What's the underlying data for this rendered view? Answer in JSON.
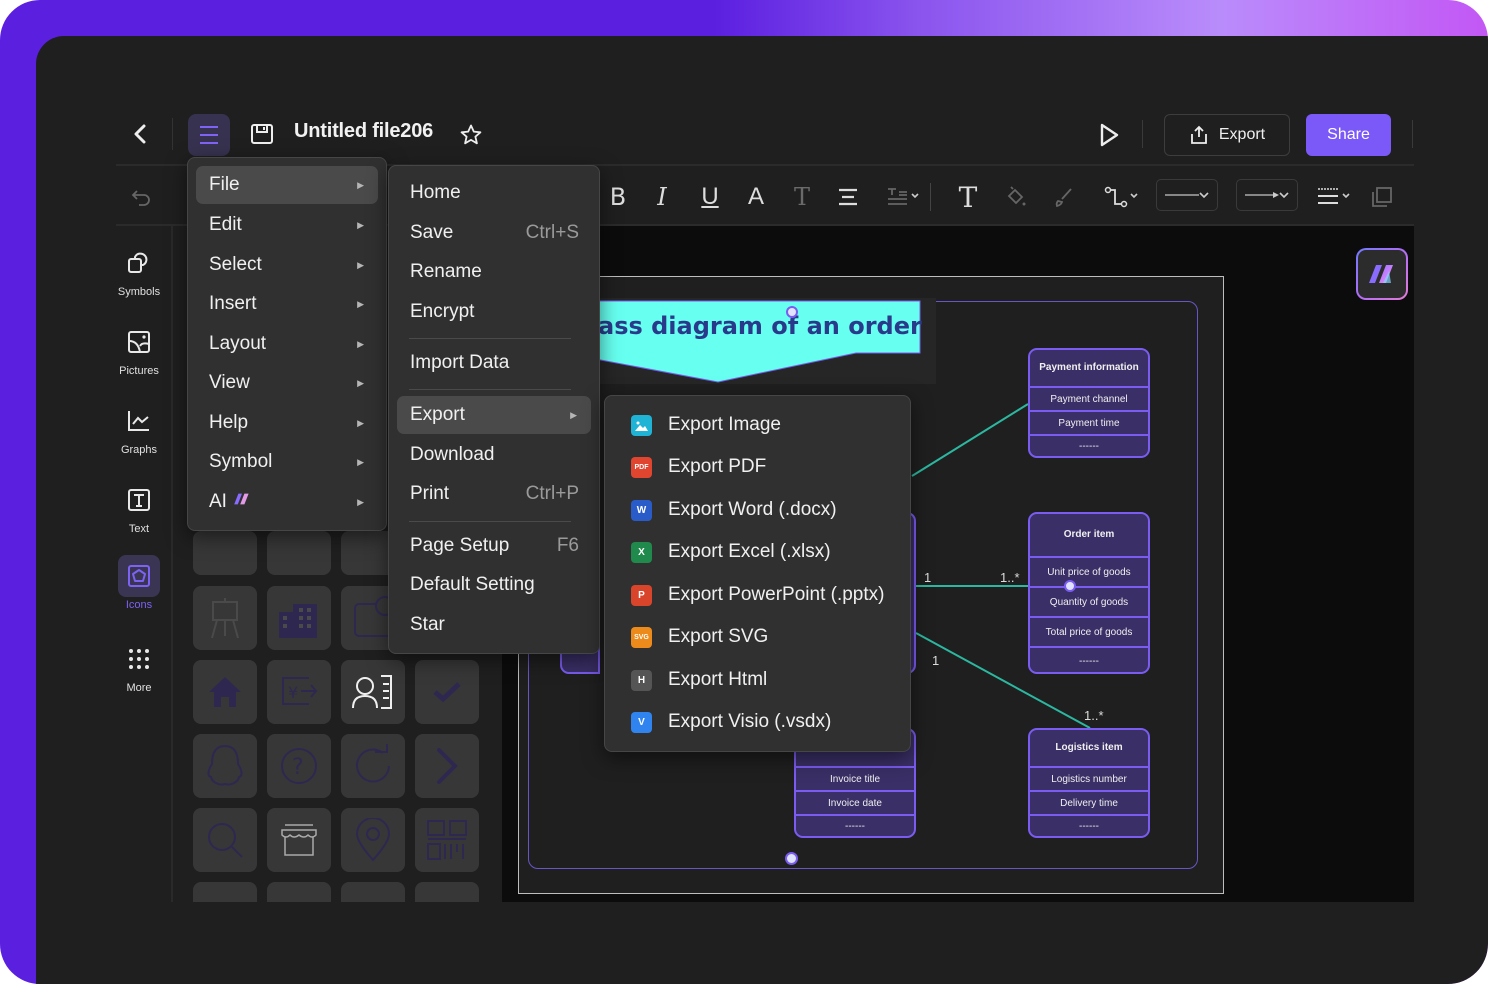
{
  "header": {
    "title": "Untitled file206",
    "export_label": "Export",
    "share_label": "Share"
  },
  "colors": {
    "accent": "#7a59f8",
    "canvas_banner": "#66fff0",
    "class_fill": "#3a2f66",
    "class_border": "#7a5cf0",
    "connector": "#2cb8a0"
  },
  "toolbar": {
    "icons": [
      "undo-icon",
      "bold-icon",
      "italic-icon",
      "underline-icon",
      "font-color-icon",
      "text-style-icon",
      "align-icon",
      "spacing-icon",
      "text-icon",
      "fill-icon",
      "brush-icon",
      "connector-icon",
      "line-style-dropdown",
      "arrow-style-dropdown",
      "line-weight-icon",
      "layer-icon"
    ]
  },
  "sidebar": {
    "items": [
      {
        "label": "Symbols",
        "icon": "symbols-icon"
      },
      {
        "label": "Pictures",
        "icon": "pictures-icon"
      },
      {
        "label": "Graphs",
        "icon": "graphs-icon"
      },
      {
        "label": "Text",
        "icon": "text-icon"
      },
      {
        "label": "Icons",
        "icon": "icons-icon",
        "active": true
      },
      {
        "label": "More",
        "icon": "more-icon"
      }
    ]
  },
  "main_menu": {
    "items": [
      {
        "label": "File",
        "selected": true
      },
      {
        "label": "Edit"
      },
      {
        "label": "Select"
      },
      {
        "label": "Insert"
      },
      {
        "label": "Layout"
      },
      {
        "label": "View"
      },
      {
        "label": "Help"
      },
      {
        "label": "Symbol"
      },
      {
        "label": "AI"
      }
    ]
  },
  "file_menu": {
    "items": [
      {
        "label": "Home",
        "shortcut": ""
      },
      {
        "label": "Save",
        "shortcut": "Ctrl+S"
      },
      {
        "label": "Rename",
        "shortcut": ""
      },
      {
        "label": "Encrypt",
        "shortcut": ""
      },
      {
        "label": "Import Data",
        "shortcut": ""
      },
      {
        "label": "Export",
        "shortcut": "",
        "selected": true
      },
      {
        "label": "Download",
        "shortcut": ""
      },
      {
        "label": "Print",
        "shortcut": "Ctrl+P"
      },
      {
        "label": "Page Setup",
        "shortcut": "F6"
      },
      {
        "label": "Default Setting",
        "shortcut": ""
      },
      {
        "label": "Star",
        "shortcut": ""
      }
    ]
  },
  "export_menu": {
    "items": [
      {
        "label": "Export Image",
        "badge": "",
        "color": "#1fb3d6"
      },
      {
        "label": "Export PDF",
        "badge": "PDF",
        "color": "#e0452f"
      },
      {
        "label": "Export Word (.docx)",
        "badge": "W",
        "color": "#2a5cc9"
      },
      {
        "label": "Export Excel (.xlsx)",
        "badge": "X",
        "color": "#1f8a4b"
      },
      {
        "label": "Export PowerPoint (.pptx)",
        "badge": "P",
        "color": "#d9452b"
      },
      {
        "label": "Export SVG",
        "badge": "SVG",
        "color": "#ec8b1c"
      },
      {
        "label": "Export Html",
        "badge": "H",
        "color": "#555555"
      },
      {
        "label": "Export Visio (.vsdx)",
        "badge": "V",
        "color": "#2f84f0"
      }
    ]
  },
  "diagram": {
    "title": "ass diagram of an order",
    "classes": {
      "payment": {
        "title": "Payment information",
        "rows": [
          "Payment channel",
          "Payment time",
          "------"
        ]
      },
      "order_item": {
        "title": "Order item",
        "rows": [
          "Unit price of goods",
          "Quantity of goods",
          "Total price of goods",
          "------"
        ]
      },
      "logistics": {
        "title": "Logistics item",
        "rows": [
          "Logistics number",
          "Delivery time",
          "------"
        ]
      },
      "invoice": {
        "title": "",
        "rows": [
          "Invoice title",
          "Invoice date",
          "------"
        ]
      }
    },
    "multiplicities": {
      "order_left": "1",
      "order_right": "1..*",
      "logistics_left": "1",
      "logistics_right": "1..*"
    }
  }
}
